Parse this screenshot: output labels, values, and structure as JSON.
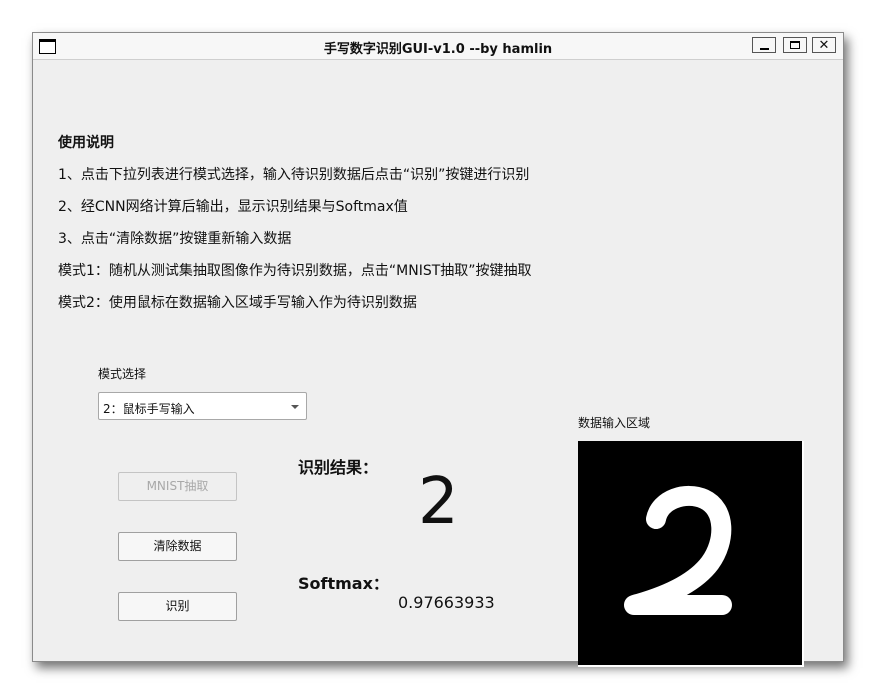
{
  "window": {
    "title": "手写数字识别GUI-v1.0 --by hamlin"
  },
  "instructions": {
    "heading": "使用说明",
    "lines": [
      "1、点击下拉列表进行模式选择，输入待识别数据后点击“识别”按键进行识别",
      "2、经CNN网络计算后输出，显示识别结果与Softmax值",
      "3、点击“清除数据”按键重新输入数据",
      "模式1：随机从测试集抽取图像作为待识别数据，点击“MNIST抽取”按键抽取",
      "模式2：使用鼠标在数据输入区域手写输入作为待识别数据"
    ]
  },
  "mode": {
    "label": "模式选择",
    "selected": "2：鼠标手写输入"
  },
  "buttons": {
    "mnist": "MNIST抽取",
    "clear": "清除数据",
    "recognize": "识别"
  },
  "result": {
    "label": "识别结果：",
    "value": "2",
    "softmax_label": "Softmax：",
    "softmax_value": "0.97663933"
  },
  "canvas": {
    "label": "数据输入区域",
    "background": "#000000",
    "stroke_color": "#ffffff"
  }
}
